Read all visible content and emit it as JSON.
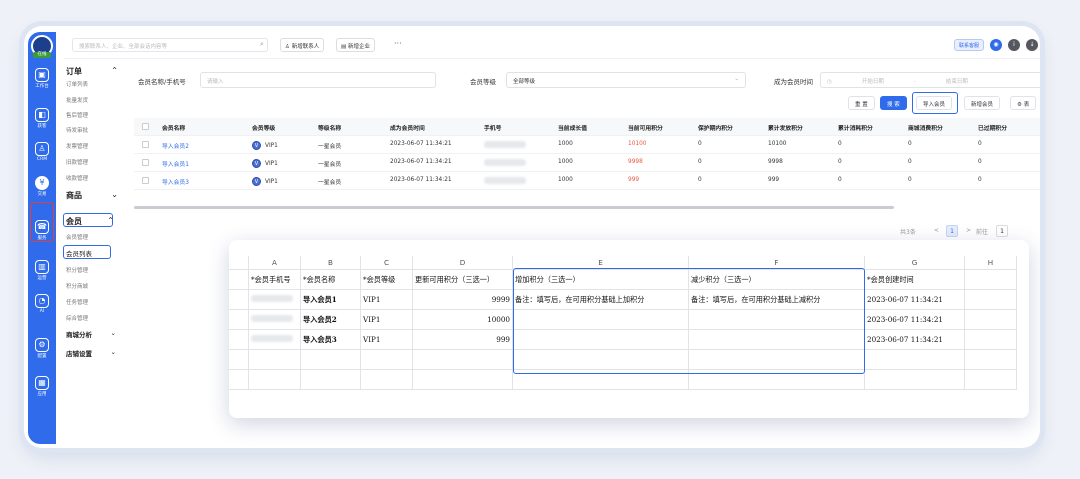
{
  "rail": {
    "logo_tag": "在线",
    "items": [
      {
        "label": "工作台",
        "icon": "workbench-icon",
        "glyph": "▣"
      },
      {
        "label": "获客",
        "icon": "acquire-icon",
        "glyph": "◧"
      },
      {
        "label": "CRM",
        "icon": "crm-icon",
        "glyph": "♙"
      },
      {
        "label": "交易",
        "icon": "trade-icon",
        "glyph": "¥"
      },
      {
        "label": "服务",
        "icon": "service-icon",
        "glyph": "☎"
      },
      {
        "label": "运营",
        "icon": "operate-icon",
        "glyph": "▥"
      },
      {
        "label": "AI",
        "icon": "ai-icon",
        "glyph": "◔"
      },
      {
        "label": "配置",
        "icon": "config-icon",
        "glyph": "⚙"
      },
      {
        "label": "应用",
        "icon": "apps-icon",
        "glyph": "▦"
      }
    ]
  },
  "subnav": {
    "orders_head": "订单",
    "orders_items": [
      "订单列表",
      "批量发货",
      "售后管理",
      "待发审批",
      "发票管理",
      "旧款管理",
      "收款管理"
    ],
    "goods_head": "商品",
    "members_head": "会员",
    "members_items": [
      "会员管理",
      "会员列表",
      "积分管理",
      "积分商城",
      "任务管理",
      "综合管理"
    ],
    "analytics_head": "商城分析",
    "store_head": "店铺设置"
  },
  "topbar": {
    "search_placeholder": "搜索联系人、企业、全部会话内容等",
    "add_contact": "新增联系人",
    "add_company": "新增企业",
    "more": "···",
    "service_btn": "联系客服"
  },
  "filters": {
    "name_phone_label": "会员名称/手机号",
    "name_phone_placeholder": "请输入",
    "level_label": "会员等级",
    "level_value": "全部等级",
    "since_label": "成为会员时间",
    "start_placeholder": "开始日期",
    "dash": "-",
    "end_placeholder": "结束日期"
  },
  "actions": {
    "reset": "重 置",
    "search": "搜 索",
    "import": "导入会员",
    "add": "新增会员",
    "settings": "表"
  },
  "member_table": {
    "headers": [
      "会员名称",
      "会员等级",
      "等级名称",
      "成为会员时间",
      "手机号",
      "当前成长值",
      "当前可用积分",
      "保护期内积分",
      "累计发放积分",
      "累计消耗积分",
      "商城消费积分",
      "已过期积分"
    ],
    "rows": [
      {
        "name": "导入会员2",
        "level": "VIP1",
        "level_name": "一星会员",
        "since": "2023-06-07 11:34:21",
        "growth": "1000",
        "points": "10100",
        "protect": "0",
        "issued": "10100",
        "consumed": "0",
        "mall": "0",
        "expired": "0"
      },
      {
        "name": "导入会员1",
        "level": "VIP1",
        "level_name": "一星会员",
        "since": "2023-06-07 11:34:21",
        "growth": "1000",
        "points": "9998",
        "protect": "0",
        "issued": "9998",
        "consumed": "0",
        "mall": "0",
        "expired": "0"
      },
      {
        "name": "导入会员3",
        "level": "VIP1",
        "level_name": "一星会员",
        "since": "2023-06-07 11:34:21",
        "growth": "1000",
        "points": "999",
        "protect": "0",
        "issued": "999",
        "consumed": "0",
        "mall": "0",
        "expired": "0"
      }
    ]
  },
  "pager": {
    "total": "共3条",
    "prev": "<",
    "page": "1",
    "next": ">",
    "goto": "前往",
    "goto_value": "1"
  },
  "sheet": {
    "columns": [
      "",
      "A",
      "B",
      "C",
      "D",
      "E",
      "F",
      "G",
      "H"
    ],
    "header_row": [
      "*会员手机号",
      "*会员名称",
      "*会员等级",
      "更新可用积分（三选一）",
      "增加积分（三选一）",
      "减少积分（三选一）",
      "*会员创建时间",
      ""
    ],
    "rows": [
      [
        "",
        "导入会员1",
        "VIP1",
        "9999",
        "备注：填写后，在可用积分基础上加积分",
        "备注：填写后，在可用积分基础上减积分",
        "2023-06-07 11:34:21",
        ""
      ],
      [
        "",
        "导入会员2",
        "VIP1",
        "10000",
        "",
        "",
        "2023-06-07 11:34:21",
        ""
      ],
      [
        "",
        "导入会员3",
        "VIP1",
        "999",
        "",
        "",
        "2023-06-07 11:34:21",
        ""
      ]
    ]
  }
}
